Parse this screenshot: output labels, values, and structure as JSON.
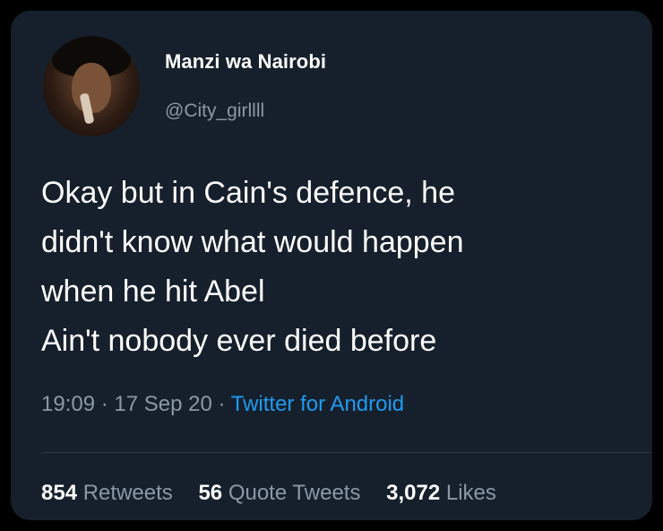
{
  "tweet": {
    "author": {
      "display_name": "Manzi wa Nairobi",
      "handle": "@City_girllll"
    },
    "text_lines": [
      "Okay but in Cain's defence, he",
      "didn't know what would happen",
      "when he hit Abel",
      "Ain't nobody ever died before"
    ],
    "time": "19:09",
    "date": "17 Sep 20",
    "separator": " · ",
    "source": "Twitter for Android",
    "stats": {
      "retweets_count": "854",
      "retweets_label": "Retweets",
      "quotes_count": "56",
      "quotes_label": "Quote Tweets",
      "likes_count": "3,072",
      "likes_label": "Likes"
    }
  },
  "colors": {
    "background": "#000000",
    "card": "#16202c",
    "primary_text": "#ffffff",
    "secondary_text": "#8b98a5",
    "accent": "#1d9bf0"
  }
}
